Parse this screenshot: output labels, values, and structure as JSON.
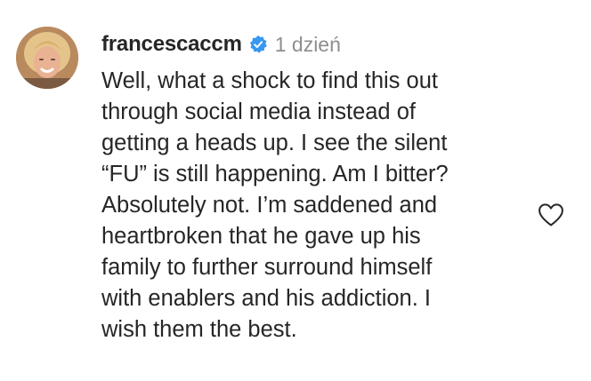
{
  "comment": {
    "username": "francescaccm",
    "verified": true,
    "time": "1 dzień",
    "lines": [
      "Well, what a shock to find this out",
      "through social media instead of",
      "getting a heads up. I see the silent",
      "“FU” is still happening. Am I bitter?",
      "Absolutely not. I’m saddened and",
      "heartbroken that he gave up his",
      "family to further surround himself",
      "with enablers and his addiction. I",
      "wish them the best."
    ],
    "colors": {
      "text": "#262626",
      "muted": "#8e8e8e",
      "verified_badge": "#3897f0"
    },
    "icons": {
      "verified": "verified-badge-icon",
      "like": "heart-outline-icon"
    }
  }
}
